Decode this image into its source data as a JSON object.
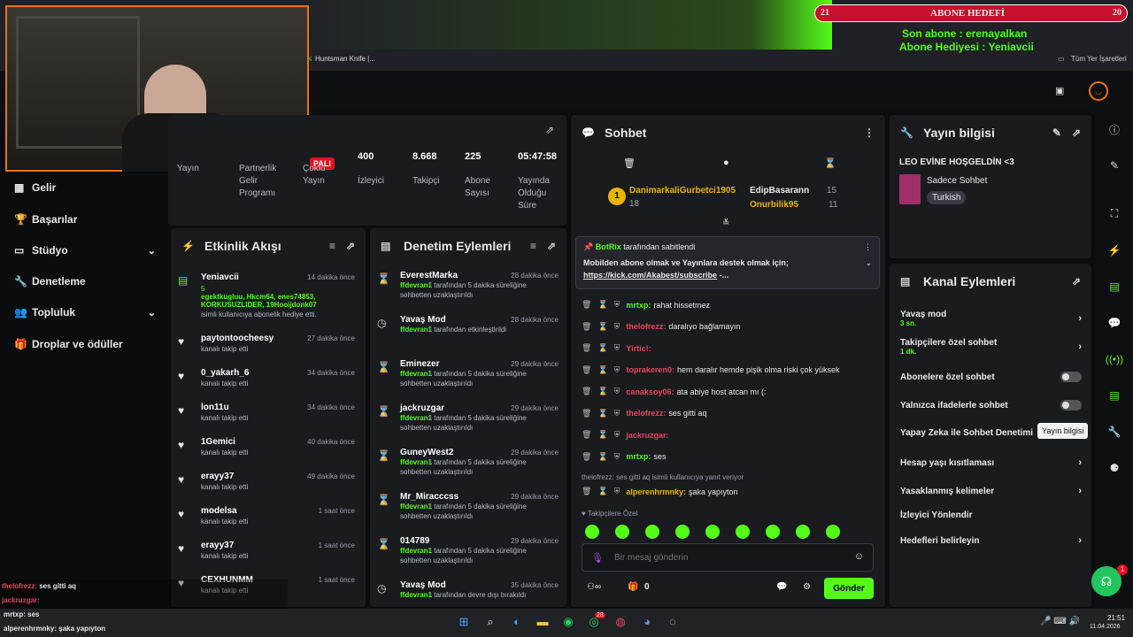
{
  "overlay": {
    "goal_title": "ABONE HEDEFİ",
    "goal_left": "21",
    "goal_right": "20",
    "last_sub": "Son abone : erenayalkan",
    "gift_sub": "Abone Hediyesi : Yeniavcii",
    "bookmark": "Huntsman Knife |...",
    "all_bookmarks": "Tüm Yer İşaretleri"
  },
  "sidebar": {
    "items": [
      {
        "label": "Gelir",
        "icon": "money-icon"
      },
      {
        "label": "Başarılar",
        "icon": "trophy-icon"
      },
      {
        "label": "Stüdyo",
        "icon": "studio-icon"
      },
      {
        "label": "Denetleme",
        "icon": "wrench-icon"
      },
      {
        "label": "Topluluk",
        "icon": "community-icon"
      },
      {
        "label": "Droplar ve ödüller",
        "icon": "gift-icon"
      }
    ]
  },
  "stats": {
    "live_badge": "PALI",
    "cols": [
      {
        "label": "Yayın",
        "value": ""
      },
      {
        "label": "Partnerlik Gelir Programı",
        "value": ""
      },
      {
        "label": "Çoklu Yayın",
        "value": ""
      },
      {
        "label": "İzleyici",
        "value": "400"
      },
      {
        "label": "Takipçi",
        "value": "8.668"
      },
      {
        "label": "Abone Sayısı",
        "value": "225"
      },
      {
        "label": "Yayında Olduğu Süre",
        "value": "05:47:58"
      }
    ]
  },
  "activity": {
    "title": "Etkinlik Akışı",
    "first": {
      "name": "Yeniavcii",
      "time": "14 dakika önce",
      "count": "5",
      "gifted": "egektkugluu, Hkcm64, enes74853, KORKUSUZLIDER, 19Hooijdonk07",
      "desc": "isimli kullanıcıya abonelik hediye etti."
    },
    "items": [
      {
        "name": "paytontoocheesy",
        "time": "27 dakika önce",
        "desc": "kanalı takip etti"
      },
      {
        "name": "0_yakarh_6",
        "time": "34 dakika önce",
        "desc": "kanalı takip etti"
      },
      {
        "name": "lon11u",
        "time": "34 dakika önce",
        "desc": "kanalı takip etti"
      },
      {
        "name": "1Gemici",
        "time": "40 dakika önce",
        "desc": "kanalı takip etti"
      },
      {
        "name": "erayy37",
        "time": "49 dakika önce",
        "desc": "kanalı takip etti"
      },
      {
        "name": "modelsa",
        "time": "1 saat önce",
        "desc": "kanalı takip etti"
      },
      {
        "name": "erayy37",
        "time": "1 saat önce",
        "desc": "kanalı takip etti"
      },
      {
        "name": "CEXHUNMM",
        "time": "1 saat önce",
        "desc": "kanalı takip etti"
      }
    ]
  },
  "moderation": {
    "title": "Denetim Eylemleri",
    "items": [
      {
        "name": "EverestMarka",
        "time": "28 dakika önce",
        "actor": "ffdevran1",
        "desc": "tarafından 5 dakika süreliğine sohbetten uzaklaştırıldı",
        "icon": "hourglass-icon"
      },
      {
        "name": "Yavaş Mod",
        "time": "28 dakika önce",
        "actor": "ffdevran1",
        "desc": "tarafından etkinleştirildi",
        "icon": "slow-mode-icon"
      },
      {
        "name": "Eminezer",
        "time": "29 dakika önce",
        "actor": "ffdevran1",
        "desc": "tarafından 5 dakika süreliğine sohbetten uzaklaştırıldı",
        "icon": "hourglass-icon"
      },
      {
        "name": "jackruzgar",
        "time": "29 dakika önce",
        "actor": "ffdevran1",
        "desc": "tarafından 5 dakika süreliğine sohbetten uzaklaştırıldı",
        "icon": "hourglass-icon"
      },
      {
        "name": "GuneyWest2",
        "time": "29 dakika önce",
        "actor": "ffdevran1",
        "desc": "tarafından 5 dakika süreliğine sohbetten uzaklaştırıldı",
        "icon": "hourglass-icon"
      },
      {
        "name": "Mr_Miracccss",
        "time": "29 dakika önce",
        "actor": "ffdevran1",
        "desc": "tarafından 5 dakika süreliğine sohbetten uzaklaştırıldı",
        "icon": "hourglass-icon"
      },
      {
        "name": "014789",
        "time": "29 dakika önce",
        "actor": "ffdevran1",
        "desc": "tarafından 5 dakika süreliğine sohbetten uzaklaştırıldı",
        "icon": "hourglass-icon"
      },
      {
        "name": "Yavaş Mod",
        "time": "35 dakika önce",
        "actor": "ffdevran1",
        "desc": "tarafından devre dışı bırakıldı",
        "icon": "slow-mode-icon"
      }
    ]
  },
  "chat": {
    "title": "Sohbet",
    "leaders": [
      {
        "rank": "1",
        "name": "DanimarkaliGurbetci1905",
        "count": "18"
      },
      {
        "name": "EdipBasarann",
        "count": "15"
      },
      {
        "name": "Onurbilik95",
        "count": "11"
      }
    ],
    "pinned_by": "BotRix",
    "pinned_suffix": "tarafından sabitlendi",
    "pinned_text": "Mobilden abone olmak ve Yayınlara destek olmak için;",
    "pinned_link": "https://kick.com/Akabest/subscribe",
    "pinned_more": "-...",
    "messages": [
      {
        "user": "mrtxp:",
        "text": "rahat hissetmez",
        "color": "#53fc18"
      },
      {
        "user": "thelofrezz:",
        "text": "daralıyo bağlamayın",
        "color": "#e8455c"
      },
      {
        "user": "Yirtic!:",
        "text": "",
        "color": "#e8455c"
      },
      {
        "user": "toprakeren0:",
        "text": "hem daralır hemde pişik olma riski çok yüksek",
        "color": "#e8455c"
      },
      {
        "user": "canaksoy06:",
        "text": "ata abiye host atcan mı (:",
        "color": "#e8455c"
      },
      {
        "user": "thelofrezz:",
        "text": "ses gitti aq",
        "color": "#e8455c"
      },
      {
        "user": "jackruzgar:",
        "text": "",
        "color": "#e8455c"
      },
      {
        "user": "mrtxp:",
        "text": "ses",
        "color": "#53fc18"
      }
    ],
    "reply_note": "thelofrezz: ses gitti aq isimli kullanıcıya yanıt veriyor",
    "reply_user": "alperenhrmnky:",
    "reply_text": "şaka yapıyton",
    "followers_only": "Takipçilere Özel",
    "input_placeholder": "Bir mesaj gönderin",
    "points": "0",
    "send_label": "Gönder"
  },
  "stream_info": {
    "title": "Yayın bilgisi",
    "stream_title": "LEO EVİNE HOŞGELDİN <3",
    "category": "Sadece Sohbet",
    "language": "Turkish"
  },
  "channel_actions": {
    "title": "Kanal Eylemleri",
    "items": [
      {
        "label": "Yavaş mod",
        "sub": "3 sn.",
        "kind": "arrow"
      },
      {
        "label": "Takipçilere özel sohbet",
        "sub": "1 dk.",
        "kind": "arrow"
      },
      {
        "label": "Abonelere özel sohbet",
        "sub": "",
        "kind": "toggle"
      },
      {
        "label": "Yalnızca ifadelerle sohbet",
        "sub": "",
        "kind": "toggle"
      },
      {
        "label": "Yapay Zeka ile Sohbet Denetimi",
        "sub": "",
        "kind": "none"
      },
      {
        "label": "Hesap yaşı kısıtlaması",
        "sub": "",
        "kind": "arrow"
      },
      {
        "label": "Yasaklanmış kelimeler",
        "sub": "",
        "kind": "arrow"
      },
      {
        "label": "İzleyici Yönlendir",
        "sub": "",
        "kind": "none"
      },
      {
        "label": "Hedefleri belirleyin",
        "sub": "",
        "kind": "arrow"
      }
    ],
    "tooltip": "Yayın bilgisi"
  },
  "overlay_chat": [
    {
      "user": "thelofrezz:",
      "text": "ses gitti aq"
    },
    {
      "user": "jackruzgar:",
      "text": ""
    },
    {
      "user": "mrtxp:",
      "text": "ses"
    },
    {
      "user": "alperenhrmnky:",
      "text": "şaka yapıyton"
    }
  ],
  "taskbar": {
    "time": "21:51",
    "date": "11.04.2026",
    "whatsapp_badge": "28",
    "notif_badge": "1"
  }
}
